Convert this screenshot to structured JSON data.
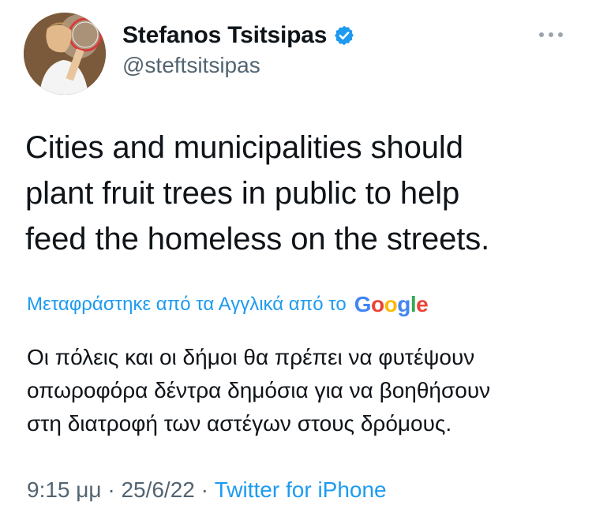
{
  "author": {
    "display_name": "Stefanos Tsitsipas",
    "handle": "@steftsitsipas",
    "verified": true
  },
  "tweet": {
    "text_lines": [
      "Cities and municipalities should",
      "plant fruit trees in public to help",
      "feed the homeless on the streets."
    ]
  },
  "translation": {
    "label": "Μεταφράστηκε από τα Αγγλικά από το",
    "provider_letters": [
      "G",
      "o",
      "o",
      "g",
      "l",
      "e"
    ],
    "text_lines": [
      "Οι πόλεις και οι δήμοι θα πρέπει να φυτέψουν",
      "οπωροφόρα δέντρα δημόσια για να βοηθήσουν",
      "στη διατροφή των αστέγων στους δρόμους."
    ]
  },
  "meta": {
    "time": "9:15 μμ",
    "separator": "·",
    "date": "25/6/22",
    "source": "Twitter for iPhone"
  },
  "colors": {
    "link_blue": "#1d9bf0",
    "secondary_text": "#536471",
    "primary_text": "#0f1419",
    "verified_badge": "#1d9bf0"
  },
  "icons": {
    "verified": "verified-badge-icon",
    "more": "more-options-icon"
  }
}
